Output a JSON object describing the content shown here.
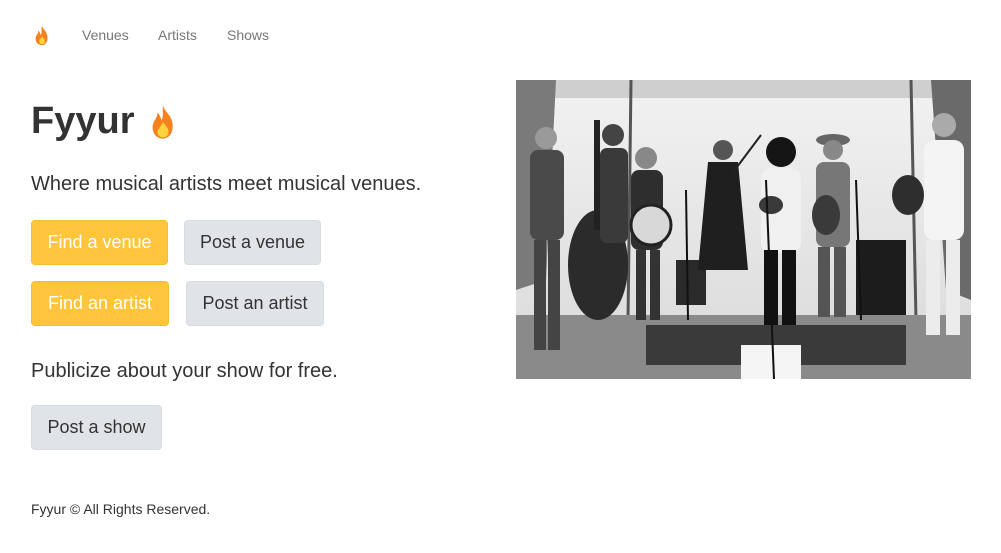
{
  "nav": {
    "logo_icon": "flame-icon",
    "links": [
      {
        "label": "Venues"
      },
      {
        "label": "Artists"
      },
      {
        "label": "Shows"
      }
    ]
  },
  "hero": {
    "title": "Fyyur",
    "title_icon": "flame-icon",
    "tagline": "Where musical artists meet musical venues.",
    "buttons": {
      "find_venue": "Find a venue",
      "post_venue": "Post a venue",
      "find_artist": "Find an artist",
      "post_artist": "Post an artist"
    },
    "publicize": "Publicize about your show for free.",
    "post_show": "Post a show"
  },
  "image": {
    "description_icon": "band-photo"
  },
  "footer": {
    "text": "Fyyur © All Rights Reserved."
  },
  "colors": {
    "primary_button": "#ffc63d",
    "default_button": "#e0e4e8",
    "nav_link": "#777777",
    "flame_outer": "#f5811f",
    "flame_inner": "#ffd23f"
  }
}
